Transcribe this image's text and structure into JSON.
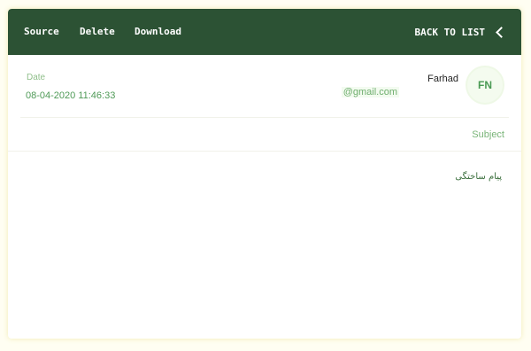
{
  "header": {
    "back_label": "BACK TO LIST",
    "actions": [
      "Download",
      "Delete",
      "Source"
    ]
  },
  "message": {
    "avatar_initials": "FN",
    "sender_name": "Farhad",
    "sender_email": "@gmail.com",
    "date_label": "Date",
    "date_value": "08-04-2020 11:46:33",
    "subject_label": "Subject",
    "body": "پیام ساختگی"
  },
  "colors": {
    "header_bg": "#2c5234",
    "accent_green": "#4f9a57",
    "page_bg": "#fffef2"
  },
  "icons": {
    "back": "chevron-left-icon"
  }
}
